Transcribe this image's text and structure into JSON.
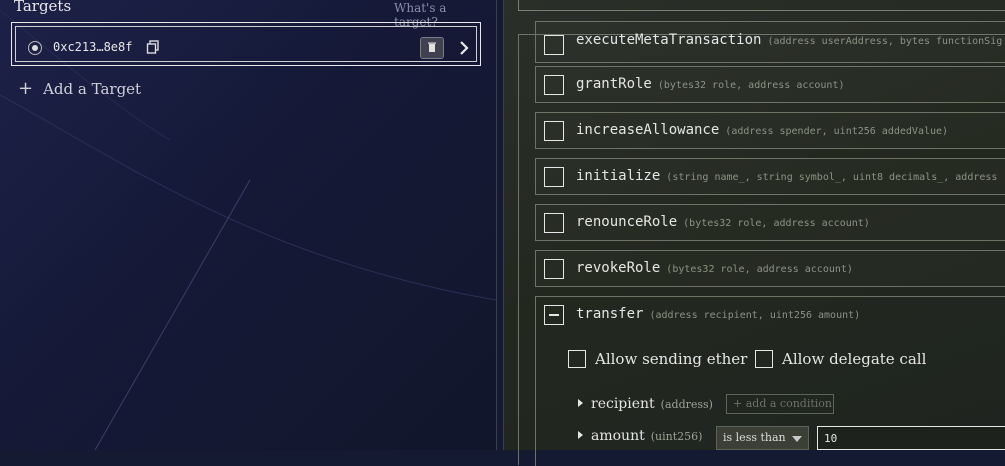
{
  "targets_panel": {
    "title": "Targets",
    "whats_link": "What's a target?",
    "target": {
      "address": "0xc213…8e8f"
    },
    "add_target_label": "Add a Target"
  },
  "functions": [
    {
      "name": "executeMetaTransaction",
      "args": "(address userAddress, bytes functionSig"
    },
    {
      "name": "grantRole",
      "args": "(bytes32 role, address account)"
    },
    {
      "name": "increaseAllowance",
      "args": "(address spender, uint256 addedValue)"
    },
    {
      "name": "initialize",
      "args": "(string name_, string symbol_, uint8 decimals_, address"
    },
    {
      "name": "renounceRole",
      "args": "(bytes32 role, address account)"
    },
    {
      "name": "revokeRole",
      "args": "(bytes32 role, address account)"
    },
    {
      "name": "transfer",
      "args": "(address recipient, uint256 amount)"
    }
  ],
  "transfer_options": {
    "allow_ether": "Allow sending ether",
    "allow_delegate": "Allow delegate call"
  },
  "params": [
    {
      "name": "recipient",
      "type": "(address)",
      "add_condition": "+ add a condition"
    },
    {
      "name": "amount",
      "type": "(uint256)",
      "operator": "is less than",
      "value": "10"
    }
  ],
  "colors": {
    "left_bg": "#161a38",
    "right_bg": "#252a22",
    "border": "#6f7366"
  }
}
